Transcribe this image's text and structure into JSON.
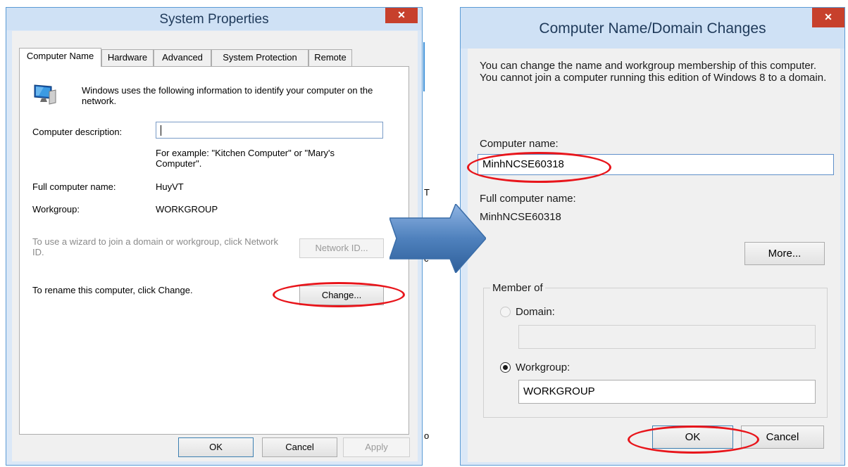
{
  "left_dialog": {
    "title": "System Properties",
    "close_glyph": "✕",
    "tabs": [
      {
        "label": "Computer Name",
        "active": true
      },
      {
        "label": "Hardware",
        "active": false
      },
      {
        "label": "Advanced",
        "active": false
      },
      {
        "label": "System Protection",
        "active": false
      },
      {
        "label": "Remote",
        "active": false
      }
    ],
    "intro": "Windows uses the following information to identify your computer on the network.",
    "computer_description_label": "Computer description:",
    "computer_description_value": "",
    "example_text": "For example: \"Kitchen Computer\" or \"Mary's Computer\".",
    "full_name_label": "Full computer name:",
    "full_name_value": "HuyVT",
    "workgroup_label": "Workgroup:",
    "workgroup_value": "WORKGROUP",
    "network_text": "To use a wizard to join a domain or workgroup, click Network ID.",
    "network_button": "Network ID...",
    "rename_text": "To rename this computer, click Change.",
    "change_button": "Change...",
    "ok_button": "OK",
    "cancel_button": "Cancel",
    "apply_button": "Apply"
  },
  "right_dialog": {
    "title": "Computer Name/Domain Changes",
    "close_glyph": "✕",
    "intro": "You can change the name and workgroup membership of this computer. You cannot join a computer running this edition of Windows 8 to a domain.",
    "computer_name_label": "Computer name:",
    "computer_name_value": "MinhNCSE60318",
    "full_name_label": "Full computer name:",
    "full_name_value": "MinhNCSE60318",
    "more_button": "More...",
    "member_of_label": "Member of",
    "domain_label": "Domain:",
    "domain_value": "",
    "workgroup_label": "Workgroup:",
    "workgroup_value": "WORKGROUP",
    "ok_button": "OK",
    "cancel_button": "Cancel"
  },
  "background_fragments": {
    "right_edge_letters": [
      "T",
      "c",
      "o"
    ]
  },
  "colors": {
    "annotation_red": "#e8151b",
    "arrow_blue": "#4f81bd",
    "close_red": "#c7402c",
    "window_frame": "#dbe8f7"
  }
}
